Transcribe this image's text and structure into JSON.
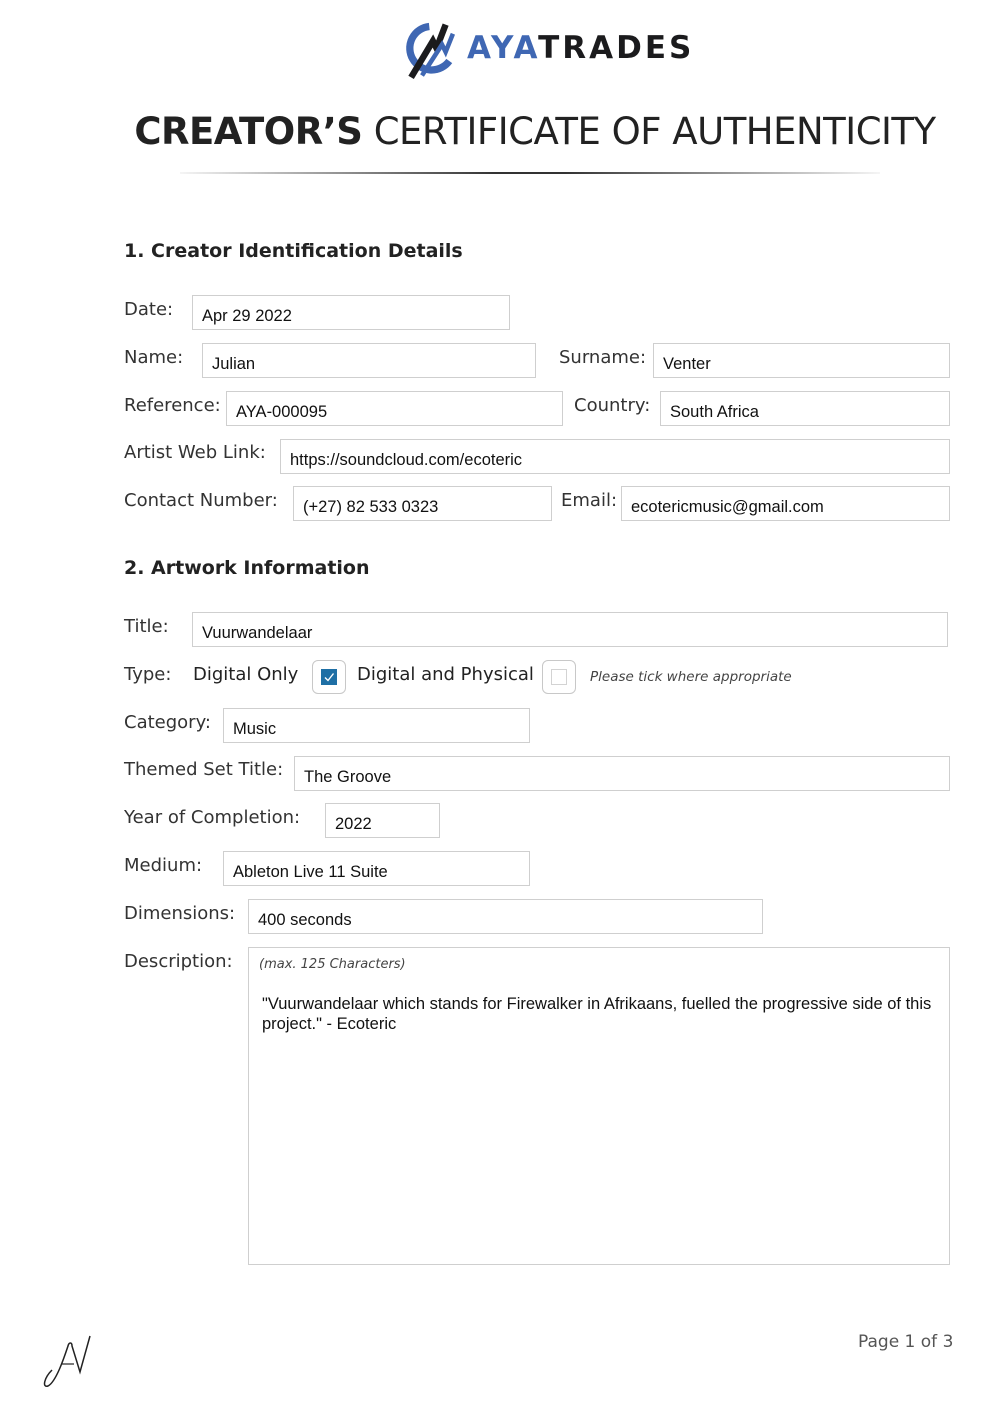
{
  "header": {
    "brand_part1": "AYA",
    "brand_part2": "TRADES",
    "title_bold": "CREATOR’S",
    "title_light": "CERTIFICATE OF AUTHENTICITY",
    "brand_color": "#3f67b3"
  },
  "creator": {
    "heading": "1. Creator Identification Details",
    "date": {
      "label": "Date:",
      "value": "Apr 29 2022"
    },
    "name": {
      "label": "Name:",
      "value": "Julian"
    },
    "surname": {
      "label": "Surname:",
      "value": "Venter"
    },
    "reference": {
      "label": "Reference:",
      "value": "AYA-000095"
    },
    "country": {
      "label": "Country:",
      "value": "South Africa"
    },
    "web_link": {
      "label": "Artist Web Link:",
      "value": "https://soundcloud.com/ecoteric"
    },
    "contact": {
      "label": "Contact Number:",
      "value": "(+27) 82 533 0323"
    },
    "email": {
      "label": "Email:",
      "value": "ecotericmusic@gmail.com"
    }
  },
  "artwork": {
    "heading": "2. Artwork Information",
    "title": {
      "label": "Title:",
      "value": "Vuurwandelaar"
    },
    "type": {
      "label": "Type:",
      "options": [
        {
          "label": "Digital Only",
          "checked": true
        },
        {
          "label": "Digital and Physical",
          "checked": false
        }
      ],
      "hint": "Please tick where appropriate"
    },
    "category": {
      "label": "Category:",
      "value": "Music"
    },
    "themed_set": {
      "label": "Themed Set Title:",
      "value": "The Groove"
    },
    "year": {
      "label": "Year of Completion:",
      "value": "2022"
    },
    "medium": {
      "label": "Medium:",
      "value": "Ableton Live 11 Suite"
    },
    "dimensions": {
      "label": "Dimensions:",
      "value": "400 seconds"
    },
    "description": {
      "label": "Description:",
      "hint": "(max. 125 Characters)",
      "value": "\"Vuurwandelaar which stands for Firewalker in Afrikaans, fuelled the progressive side of this project.\" - Ecoteric"
    }
  },
  "footer": {
    "signature_icon": "signature-initials",
    "page": "Page 1 of 3"
  }
}
